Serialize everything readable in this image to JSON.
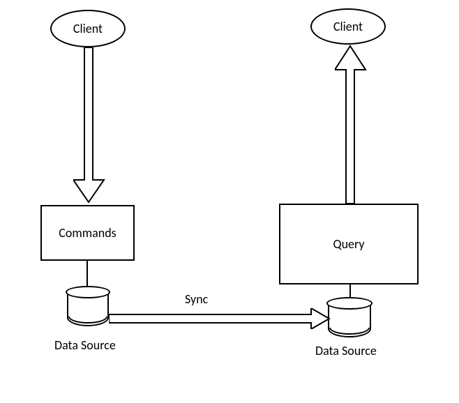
{
  "chart_data": {
    "type": "diagram",
    "title": "CQRS Architecture Diagram",
    "nodes": [
      {
        "id": "client-left",
        "shape": "ellipse",
        "label": "Client"
      },
      {
        "id": "client-right",
        "shape": "ellipse",
        "label": "Client"
      },
      {
        "id": "commands",
        "shape": "rectangle",
        "label": "Commands"
      },
      {
        "id": "query",
        "shape": "rectangle",
        "label": "Query"
      },
      {
        "id": "datasource-left",
        "shape": "cylinder",
        "label": "Data Source"
      },
      {
        "id": "datasource-right",
        "shape": "cylinder",
        "label": "Data Source"
      }
    ],
    "edges": [
      {
        "from": "client-left",
        "to": "commands",
        "type": "block-arrow",
        "direction": "down"
      },
      {
        "from": "commands",
        "to": "datasource-left",
        "type": "line",
        "direction": "down"
      },
      {
        "from": "datasource-left",
        "to": "datasource-right",
        "type": "block-arrow",
        "direction": "right",
        "label": "Sync"
      },
      {
        "from": "datasource-right",
        "to": "query",
        "type": "line",
        "direction": "up"
      },
      {
        "from": "query",
        "to": "client-right",
        "type": "block-arrow",
        "direction": "up"
      }
    ]
  },
  "labels": {
    "client_left": "Client",
    "client_right": "Client",
    "commands": "Commands",
    "query": "Query",
    "sync": "Sync",
    "datasource_left": "Data Source",
    "datasource_right": "Data Source"
  }
}
